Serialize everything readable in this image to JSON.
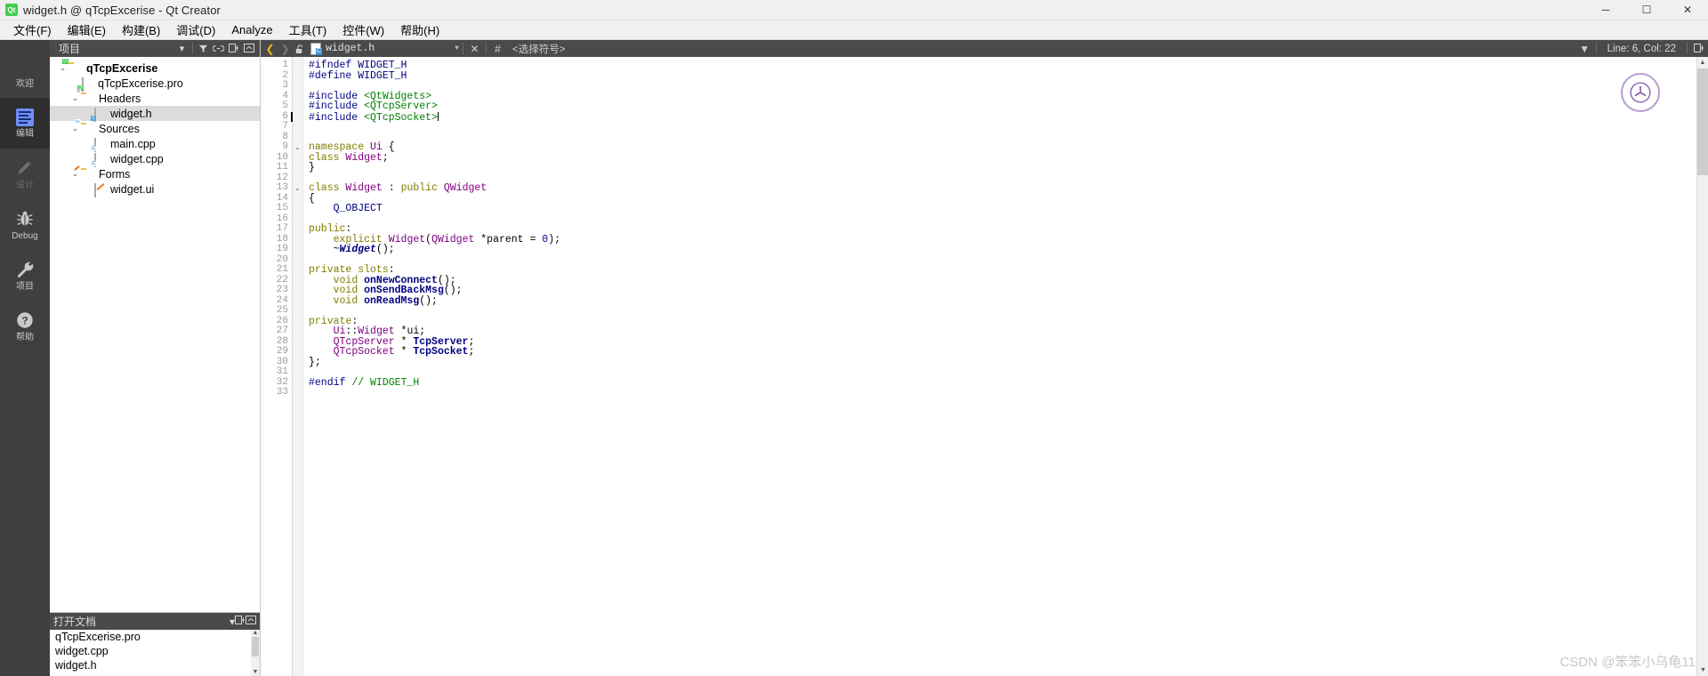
{
  "window": {
    "title": "widget.h @ qTcpExcerise - Qt Creator",
    "logo_text": "Qt",
    "minimize": "─",
    "maximize": "☐",
    "close": "✕"
  },
  "menubar": {
    "items": [
      {
        "label": "文件(F)",
        "mnemonic": "F"
      },
      {
        "label": "编辑(E)",
        "mnemonic": "E"
      },
      {
        "label": "构建(B)",
        "mnemonic": "B"
      },
      {
        "label": "调试(D)",
        "mnemonic": "D"
      },
      {
        "label": "Analyze",
        "mnemonic": "A"
      },
      {
        "label": "工具(T)",
        "mnemonic": "T"
      },
      {
        "label": "控件(W)",
        "mnemonic": "W"
      },
      {
        "label": "帮助(H)",
        "mnemonic": "H"
      }
    ]
  },
  "modebar": {
    "items": [
      {
        "label": "欢迎",
        "icon": "grid-icon",
        "active": false
      },
      {
        "label": "编辑",
        "icon": "edit-icon",
        "active": true
      },
      {
        "label": "设计",
        "icon": "pencil-icon",
        "active": false,
        "disabled": true
      },
      {
        "label": "Debug",
        "icon": "bug-icon",
        "active": false
      },
      {
        "label": "项目",
        "icon": "wrench-icon",
        "active": false
      },
      {
        "label": "帮助",
        "icon": "question-icon",
        "active": false
      }
    ]
  },
  "project_panel": {
    "title": "项目",
    "header_icons": [
      "chevron-down-icon",
      "filter-icon",
      "link-icon",
      "split-icon",
      "close-panel-icon"
    ],
    "tree": [
      {
        "label": "qTcpExcerise",
        "indent": 0,
        "arrow": "⌄",
        "icon": "qt-project-folder-icon",
        "bold": true,
        "selected": false
      },
      {
        "label": "qTcpExcerise.pro",
        "indent": 1,
        "arrow": "",
        "icon": "qt-pro-file-icon",
        "bold": false,
        "selected": false
      },
      {
        "label": "Headers",
        "indent": 1,
        "arrow": "⌄",
        "icon": "headers-folder-icon",
        "bold": false,
        "selected": false
      },
      {
        "label": "widget.h",
        "indent": 2,
        "arrow": "",
        "icon": "header-file-icon",
        "bold": false,
        "selected": true
      },
      {
        "label": "Sources",
        "indent": 1,
        "arrow": "⌄",
        "icon": "sources-folder-icon",
        "bold": false,
        "selected": false
      },
      {
        "label": "main.cpp",
        "indent": 2,
        "arrow": "",
        "icon": "cpp-file-icon",
        "bold": false,
        "selected": false
      },
      {
        "label": "widget.cpp",
        "indent": 2,
        "arrow": "",
        "icon": "cpp-file-icon",
        "bold": false,
        "selected": false
      },
      {
        "label": "Forms",
        "indent": 1,
        "arrow": "⌄",
        "icon": "forms-folder-icon",
        "bold": false,
        "selected": false
      },
      {
        "label": "widget.ui",
        "indent": 2,
        "arrow": "",
        "icon": "ui-file-icon",
        "bold": false,
        "selected": false
      }
    ]
  },
  "open_documents": {
    "title": "打开文档",
    "header_icons": [
      "chevron-down-icon",
      "split-icon",
      "close-panel-icon"
    ],
    "items": [
      {
        "label": "qTcpExcerise.pro"
      },
      {
        "label": "widget.cpp"
      },
      {
        "label": "widget.h"
      }
    ]
  },
  "editor_toolbar": {
    "back_icon": "back-arrow-icon",
    "forward_icon": "forward-arrow-icon",
    "lock_icon": "unlock-icon",
    "file_name": "widget.h",
    "file_dropdown_icon": "chevron-down-icon",
    "close_icon": "close-icon",
    "hash_icon": "hash-icon",
    "symbol_selector": "<选择符号>",
    "line_col": "Line: 6, Col: 22",
    "split_icon": "split-editor-icon",
    "right_chevron_icon": "chevron-down-icon"
  },
  "editor": {
    "current_line": 6,
    "cursor_col": 22,
    "lines": [
      {
        "n": 1,
        "fold": "",
        "tokens": [
          {
            "t": "#ifndef WIDGET_H",
            "c": "t-pre"
          }
        ]
      },
      {
        "n": 2,
        "fold": "",
        "tokens": [
          {
            "t": "#define WIDGET_H",
            "c": "t-pre"
          }
        ]
      },
      {
        "n": 3,
        "fold": "",
        "tokens": []
      },
      {
        "n": 4,
        "fold": "",
        "tokens": [
          {
            "t": "#include ",
            "c": "t-pre"
          },
          {
            "t": "<QtWidgets>",
            "c": "t-str"
          }
        ]
      },
      {
        "n": 5,
        "fold": "",
        "tokens": [
          {
            "t": "#include ",
            "c": "t-pre"
          },
          {
            "t": "<QTcpServer>",
            "c": "t-str"
          }
        ]
      },
      {
        "n": 6,
        "fold": "",
        "tokens": [
          {
            "t": "#include ",
            "c": "t-pre"
          },
          {
            "t": "<QTcpSocket>",
            "c": "t-str"
          }
        ]
      },
      {
        "n": 7,
        "fold": "",
        "tokens": []
      },
      {
        "n": 8,
        "fold": "",
        "tokens": []
      },
      {
        "n": 9,
        "fold": "⌄",
        "tokens": [
          {
            "t": "namespace ",
            "c": "t-kw"
          },
          {
            "t": "Ui",
            "c": "t-key"
          },
          {
            "t": " {",
            "c": "t-pln"
          }
        ]
      },
      {
        "n": 10,
        "fold": "",
        "tokens": [
          {
            "t": "class ",
            "c": "t-kw"
          },
          {
            "t": "Widget",
            "c": "t-key"
          },
          {
            "t": ";",
            "c": "t-pln"
          }
        ]
      },
      {
        "n": 11,
        "fold": "",
        "tokens": [
          {
            "t": "}",
            "c": "t-pln"
          }
        ]
      },
      {
        "n": 12,
        "fold": "",
        "tokens": []
      },
      {
        "n": 13,
        "fold": "⌄",
        "tokens": [
          {
            "t": "class ",
            "c": "t-kw"
          },
          {
            "t": "Widget",
            "c": "t-key"
          },
          {
            "t": " : ",
            "c": "t-pln"
          },
          {
            "t": "public ",
            "c": "t-kw"
          },
          {
            "t": "QWidget",
            "c": "t-key"
          }
        ]
      },
      {
        "n": 14,
        "fold": "",
        "tokens": [
          {
            "t": "{",
            "c": "t-pln"
          }
        ]
      },
      {
        "n": 15,
        "fold": "",
        "tokens": [
          {
            "t": "    ",
            "c": "t-pln"
          },
          {
            "t": "Q_OBJECT",
            "c": "t-mac"
          }
        ]
      },
      {
        "n": 16,
        "fold": "",
        "tokens": []
      },
      {
        "n": 17,
        "fold": "",
        "tokens": [
          {
            "t": "public",
            "c": "t-kw"
          },
          {
            "t": ":",
            "c": "t-pln"
          }
        ]
      },
      {
        "n": 18,
        "fold": "",
        "tokens": [
          {
            "t": "    ",
            "c": "t-pln"
          },
          {
            "t": "explicit ",
            "c": "t-kw"
          },
          {
            "t": "Widget",
            "c": "t-key"
          },
          {
            "t": "(",
            "c": "t-pln"
          },
          {
            "t": "QWidget",
            "c": "t-key"
          },
          {
            "t": " *parent = ",
            "c": "t-pln"
          },
          {
            "t": "0",
            "c": "t-num"
          },
          {
            "t": ");",
            "c": "t-pln"
          }
        ]
      },
      {
        "n": 19,
        "fold": "",
        "tokens": [
          {
            "t": "    ~",
            "c": "t-pln"
          },
          {
            "t": "Widget",
            "c": "t-fni"
          },
          {
            "t": "();",
            "c": "t-pln"
          }
        ]
      },
      {
        "n": 20,
        "fold": "",
        "tokens": []
      },
      {
        "n": 21,
        "fold": "",
        "tokens": [
          {
            "t": "private slots",
            "c": "t-kw"
          },
          {
            "t": ":",
            "c": "t-pln"
          }
        ]
      },
      {
        "n": 22,
        "fold": "",
        "tokens": [
          {
            "t": "    ",
            "c": "t-pln"
          },
          {
            "t": "void ",
            "c": "t-kw"
          },
          {
            "t": "onNewConnect",
            "c": "t-fn"
          },
          {
            "t": "();",
            "c": "t-pln"
          }
        ]
      },
      {
        "n": 23,
        "fold": "",
        "tokens": [
          {
            "t": "    ",
            "c": "t-pln"
          },
          {
            "t": "void ",
            "c": "t-kw"
          },
          {
            "t": "onSendBackMsg",
            "c": "t-fn"
          },
          {
            "t": "();",
            "c": "t-pln"
          }
        ]
      },
      {
        "n": 24,
        "fold": "",
        "tokens": [
          {
            "t": "    ",
            "c": "t-pln"
          },
          {
            "t": "void ",
            "c": "t-kw"
          },
          {
            "t": "onReadMsg",
            "c": "t-fn"
          },
          {
            "t": "();",
            "c": "t-pln"
          }
        ]
      },
      {
        "n": 25,
        "fold": "",
        "tokens": []
      },
      {
        "n": 26,
        "fold": "",
        "tokens": [
          {
            "t": "private",
            "c": "t-kw"
          },
          {
            "t": ":",
            "c": "t-pln"
          }
        ]
      },
      {
        "n": 27,
        "fold": "",
        "tokens": [
          {
            "t": "    ",
            "c": "t-pln"
          },
          {
            "t": "Ui",
            "c": "t-key"
          },
          {
            "t": "::",
            "c": "t-pln"
          },
          {
            "t": "Widget",
            "c": "t-key"
          },
          {
            "t": " *ui;",
            "c": "t-pln"
          }
        ]
      },
      {
        "n": 28,
        "fold": "",
        "tokens": [
          {
            "t": "    ",
            "c": "t-pln"
          },
          {
            "t": "QTcpServer",
            "c": "t-key"
          },
          {
            "t": " * ",
            "c": "t-pln"
          },
          {
            "t": "TcpServer",
            "c": "t-fn"
          },
          {
            "t": ";",
            "c": "t-pln"
          }
        ]
      },
      {
        "n": 29,
        "fold": "",
        "tokens": [
          {
            "t": "    ",
            "c": "t-pln"
          },
          {
            "t": "QTcpSocket",
            "c": "t-key"
          },
          {
            "t": " * ",
            "c": "t-pln"
          },
          {
            "t": "TcpSocket",
            "c": "t-fn"
          },
          {
            "t": ";",
            "c": "t-pln"
          }
        ]
      },
      {
        "n": 30,
        "fold": "",
        "tokens": [
          {
            "t": "};",
            "c": "t-pln"
          }
        ]
      },
      {
        "n": 31,
        "fold": "",
        "tokens": []
      },
      {
        "n": 32,
        "fold": "",
        "tokens": [
          {
            "t": "#endif ",
            "c": "t-pre"
          },
          {
            "t": "// WIDGET_H",
            "c": "t-cmt"
          }
        ]
      },
      {
        "n": 33,
        "fold": "",
        "tokens": []
      }
    ]
  },
  "watermark": {
    "text": "CSDN @笨笨小乌龟11"
  },
  "colors": {
    "mode_bar_bg": "#3f3f3f",
    "panel_header_bg": "#4a4a4a",
    "selection_bg": "#dcdcdc",
    "accent_green": "#41cd52",
    "preprocessor": "#000080",
    "string": "#008000",
    "keyword": "#808000",
    "type": "#800080"
  }
}
